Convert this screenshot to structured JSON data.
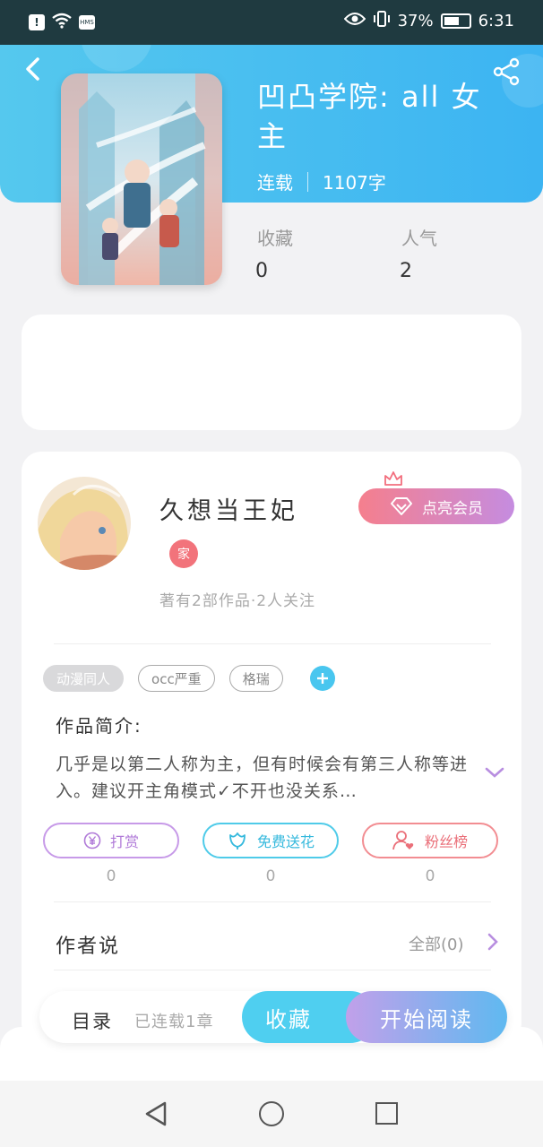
{
  "status_bar": {
    "alert_icon": "alert-icon",
    "wifi_icon": "wifi-icon",
    "hms_label": "HMS",
    "battery_pct": "37%",
    "time": "6:31"
  },
  "book": {
    "title": "凹凸学院: all 女主",
    "status": "连载",
    "word_count": "1107字",
    "favorites_label": "收藏",
    "favorites_value": "0",
    "popularity_label": "人气",
    "popularity_value": "2"
  },
  "author": {
    "name": "久想当王妃",
    "badge": "家",
    "stats": "著有2部作品·2人关注",
    "vip_label": "点亮会员"
  },
  "tags": [
    "动漫同人",
    "occ严重",
    "格瑞"
  ],
  "intro": {
    "title": "作品简介:",
    "text": "几乎是以第二人称为主，但有时候会有第三人称等进入。建议开主角模式✓不开也没关系…"
  },
  "actions": {
    "reward_label": "打赏",
    "reward_count": "0",
    "flower_label": "免费送花",
    "flower_count": "0",
    "fans_label": "粉丝榜",
    "fans_count": "0"
  },
  "author_says": {
    "title": "作者说",
    "all_label": "全部(0)"
  },
  "bottom": {
    "toc_label": "目录",
    "toc_status": "已连载1章",
    "favorite_button": "收藏",
    "read_button": "开始阅读"
  },
  "colors": {
    "header_gradient_start": "#55c8ee",
    "header_gradient_end": "#3cb4f2",
    "vip_gradient_start": "#f57f8d",
    "vip_gradient_end": "#c58ce0",
    "accent_blue": "#4fcff0"
  }
}
